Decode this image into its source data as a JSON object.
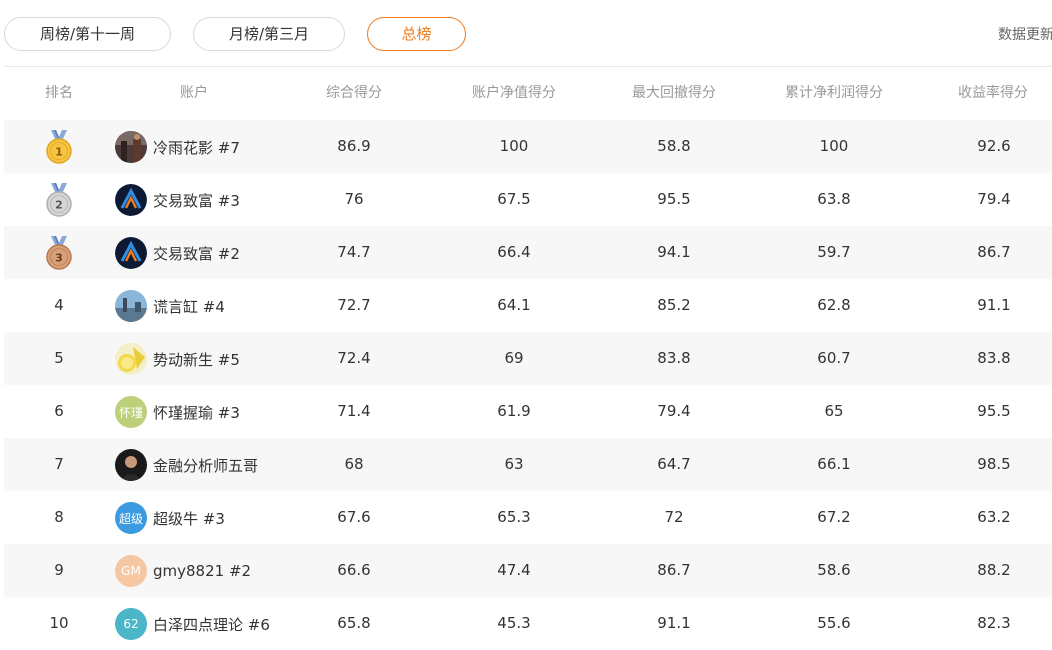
{
  "tabs": [
    {
      "label": "周榜/第十一周",
      "active": false
    },
    {
      "label": "月榜/第三月",
      "active": false
    },
    {
      "label": "总榜",
      "active": true
    }
  ],
  "update_text": "数据更新",
  "columns": [
    "排名",
    "账户",
    "综合得分",
    "账户净值得分",
    "最大回撤得分",
    "累计净利润得分",
    "收益率得分"
  ],
  "colors": {
    "accent": "#f07a1c",
    "gold": "#f6c343",
    "silver": "#d6d6d6",
    "bronze": "#d8a07a",
    "row_alt": "#f7f7f7"
  },
  "rows": [
    {
      "rank": "1",
      "medal": "gold",
      "avatar": {
        "type": "photo-dusk-icon",
        "text": ""
      },
      "account": "冷雨花影 #7",
      "composite": "86.9",
      "net_value": "100",
      "max_drawdown": "58.8",
      "net_profit": "100",
      "return_rate": "92.6"
    },
    {
      "rank": "2",
      "medal": "silver",
      "avatar": {
        "type": "logo-a-icon",
        "text": ""
      },
      "account": "交易致富 #3",
      "composite": "76",
      "net_value": "67.5",
      "max_drawdown": "95.5",
      "net_profit": "63.8",
      "return_rate": "79.4"
    },
    {
      "rank": "3",
      "medal": "bronze",
      "avatar": {
        "type": "logo-a-icon",
        "text": ""
      },
      "account": "交易致富 #2",
      "composite": "74.7",
      "net_value": "66.4",
      "max_drawdown": "94.1",
      "net_profit": "59.7",
      "return_rate": "86.7"
    },
    {
      "rank": "4",
      "medal": "",
      "avatar": {
        "type": "photo-sky-icon",
        "text": ""
      },
      "account": "谎言缸 #4",
      "composite": "72.7",
      "net_value": "64.1",
      "max_drawdown": "85.2",
      "net_profit": "62.8",
      "return_rate": "91.1"
    },
    {
      "rank": "5",
      "medal": "",
      "avatar": {
        "type": "photo-lemon-icon",
        "text": ""
      },
      "account": "势动新生 #5",
      "composite": "72.4",
      "net_value": "69",
      "max_drawdown": "83.8",
      "net_profit": "60.7",
      "return_rate": "83.8"
    },
    {
      "rank": "6",
      "medal": "",
      "avatar": {
        "type": "text",
        "text": "怀瑾",
        "color": "#bcd07a"
      },
      "account": "怀瑾握瑜 #3",
      "composite": "71.4",
      "net_value": "61.9",
      "max_drawdown": "79.4",
      "net_profit": "65",
      "return_rate": "95.5"
    },
    {
      "rank": "7",
      "medal": "",
      "avatar": {
        "type": "photo-person-icon",
        "text": ""
      },
      "account": "金融分析师五哥",
      "composite": "68",
      "net_value": "63",
      "max_drawdown": "64.7",
      "net_profit": "66.1",
      "return_rate": "98.5"
    },
    {
      "rank": "8",
      "medal": "",
      "avatar": {
        "type": "text",
        "text": "超级",
        "color": "#3a9be0"
      },
      "account": "超级牛 #3",
      "composite": "67.6",
      "net_value": "65.3",
      "max_drawdown": "72",
      "net_profit": "67.2",
      "return_rate": "63.2"
    },
    {
      "rank": "9",
      "medal": "",
      "avatar": {
        "type": "text",
        "text": "GM",
        "color": "#f5c7a3"
      },
      "account": "gmy8821 #2",
      "composite": "66.6",
      "net_value": "47.4",
      "max_drawdown": "86.7",
      "net_profit": "58.6",
      "return_rate": "88.2"
    },
    {
      "rank": "10",
      "medal": "",
      "avatar": {
        "type": "text",
        "text": "62",
        "color": "#4bb6c8"
      },
      "account": "白泽四点理论 #6",
      "composite": "65.8",
      "net_value": "45.3",
      "max_drawdown": "91.1",
      "net_profit": "55.6",
      "return_rate": "82.3"
    }
  ]
}
